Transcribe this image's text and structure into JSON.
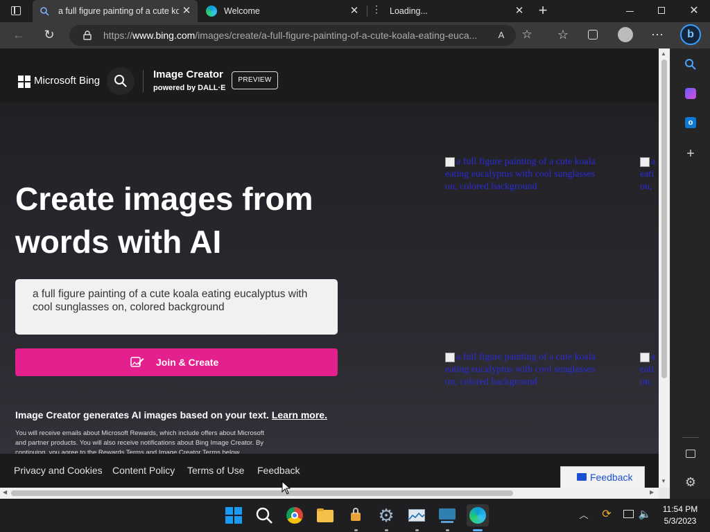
{
  "browser": {
    "tabs": [
      {
        "title": "a full figure painting of a cute ko",
        "active": true
      },
      {
        "title": "Welcome",
        "active": false
      },
      {
        "title": "Loading...",
        "active": false
      }
    ],
    "url_prefix": "https://",
    "url_domain": "www.bing.com",
    "url_rest": "/images/create/a-full-figure-painting-of-a-cute-koala-eating-euca..."
  },
  "header": {
    "brand": "Microsoft Bing",
    "product_title": "Image Creator",
    "product_sub": "powered by DALL·E",
    "preview_badge": "PREVIEW"
  },
  "hero": {
    "headline_line1": "Create images from",
    "headline_line2": "words with AI",
    "prompt_text": "a full figure painting of a cute koala eating eucalyptus with cool sunglasses on, colored background",
    "join_button": "Join & Create",
    "info_text": "Image Creator generates AI images based on your text.",
    "learn_more": "Learn more.",
    "fine_print_1": "You will receive emails about Microsoft Rewards, which include offers about Microsoft",
    "fine_print_2": "and partner products. You will also receive notifications about Bing Image Creator. By",
    "fine_print_3": "continuing, you agree to the Rewards Terms and Image Creator Terms below."
  },
  "images": {
    "alt": "a full figure painting of a cute koala eating eucalyptus with cool sunglasses on, colored background",
    "alt_line1": "a full figure painting of a cute koala",
    "alt_line2": "eating eucalyptus with cool sunglasses",
    "alt_line3": "on, colored background",
    "alt_clip1": "a",
    "alt_clip2": "eati",
    "alt_clip3": "on,"
  },
  "footer": {
    "links": [
      "Privacy and Cookies",
      "Content Policy",
      "Terms of Use",
      "Feedback"
    ],
    "feedback_button": "Feedback"
  },
  "taskbar": {
    "time": "11:54 PM",
    "date": "5/3/2023"
  },
  "colors": {
    "accent_pink": "#e3208e",
    "link_blue": "#2b2bd8",
    "feedback_blue": "#1b4fd1"
  }
}
